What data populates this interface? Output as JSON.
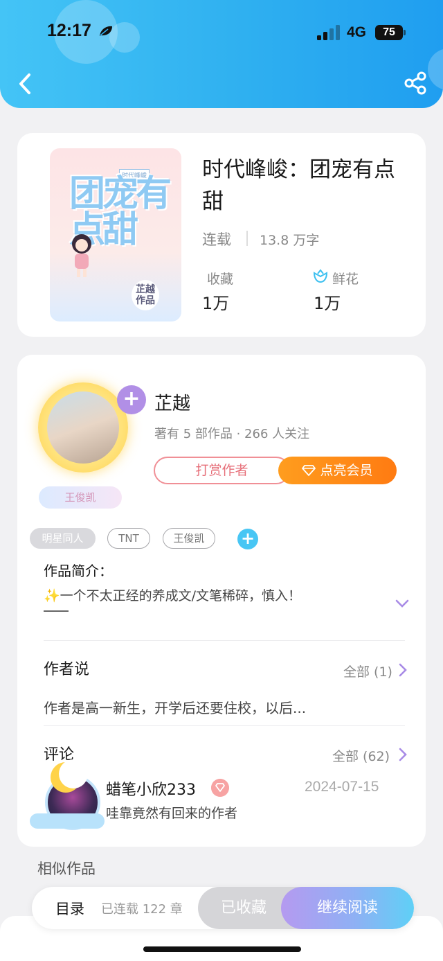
{
  "status_bar": {
    "time": "12:17",
    "network": "4G",
    "battery": "75"
  },
  "book": {
    "cover": {
      "title": "团宠有点甜",
      "tag": "时代峰峻",
      "author_mark": "芷越作品"
    },
    "title": "时代峰峻：团宠有点甜",
    "status": "连载",
    "word_count": "13.8 万字",
    "stats": [
      {
        "label": "收藏",
        "value": "1万"
      },
      {
        "label": "鲜花",
        "value": "1万",
        "icon": "flower-icon"
      }
    ]
  },
  "author": {
    "name": "芷越",
    "meta": "著有 5 部作品 · 266 人关注",
    "badge": "王俊凯",
    "tip_button": "打赏作者",
    "vip_button": "点亮会员"
  },
  "tags": [
    "明星同人",
    "TNT",
    "王俊凯"
  ],
  "intro": {
    "title": "作品简介：",
    "text": "✨一个不太正经的养成文/文笔稀碎，慎入！"
  },
  "author_says": {
    "title": "作者说",
    "more": "全部 (1)",
    "text": "作者是高一新生，开学后还要住校，以后..."
  },
  "comments": {
    "title": "评论",
    "more": "全部 (62)",
    "items": [
      {
        "user": "蜡笔小欣233",
        "date": "2024-07-15",
        "text": "哇靠竟然有回来的作者"
      }
    ]
  },
  "similar": {
    "title": "相似作品"
  },
  "action_bar": {
    "toc": "目录",
    "chapters": "已连载 122 章",
    "collected": "已收藏",
    "continue": "继续阅读"
  },
  "colors": {
    "header": "#2fb0f0",
    "vip": "#ff8a18",
    "accent_purple": "#b18fe6"
  }
}
